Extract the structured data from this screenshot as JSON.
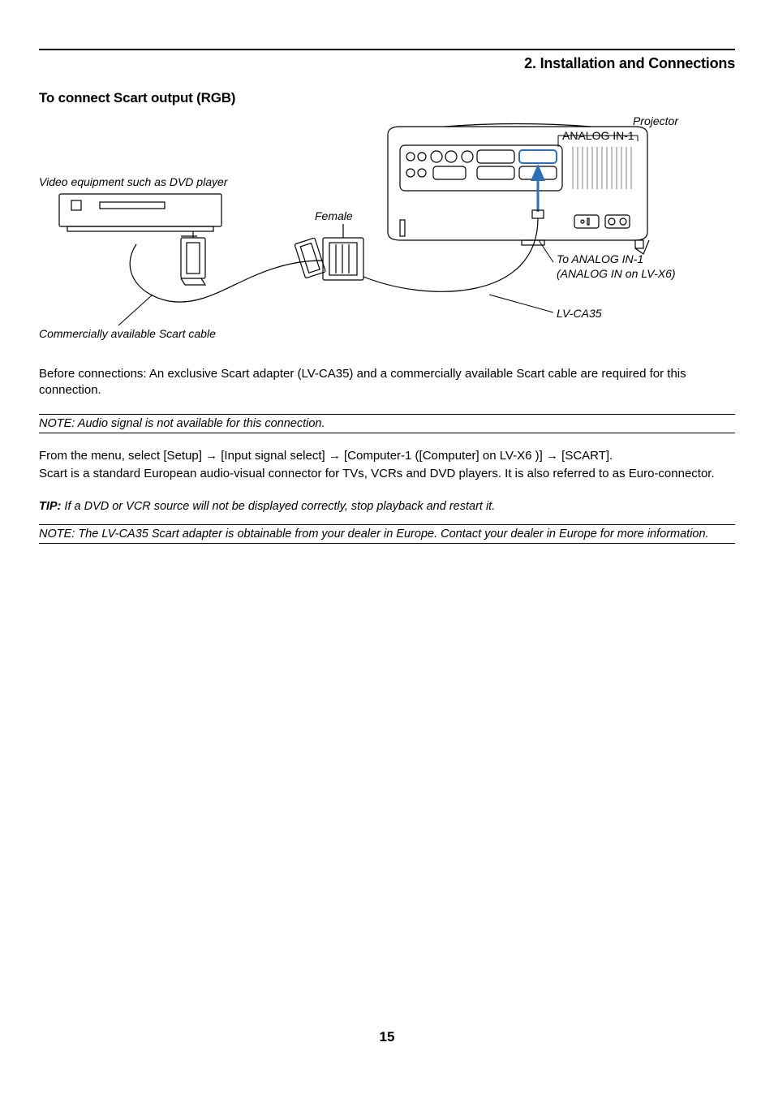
{
  "header": {
    "chapter": "2. Installation and Connections"
  },
  "section": {
    "title": "To connect Scart output (RGB)"
  },
  "diagram": {
    "projector_label": "Projector",
    "analog_in_label": "ANALOG IN-1",
    "to_analog_label_line1": "To ANALOG IN-1",
    "to_analog_label_line2": "(ANALOG IN on LV-X6)",
    "lv_ca35_label": "LV-CA35",
    "video_equipment_label": "Video equipment such as DVD player",
    "female_label": "Female",
    "scart_cable_label": "Commercially available Scart cable"
  },
  "body": {
    "before_connections": "Before connections: An exclusive Scart adapter (LV-CA35) and a commercially available Scart cable are required for this connection.",
    "note1": "NOTE: Audio signal is not available for this connection.",
    "menu_line1": "From the menu, select [Setup] → [Input signal select] → [Computer-1 ([Computer] on LV-X6 )] → [SCART].",
    "menu_line2": "Scart is a standard European audio-visual connector for TVs, VCRs and DVD players. It is also referred to as Euro-connector.",
    "tip_label": "TIP:",
    "tip_body": " If a DVD or VCR source will not be displayed correctly, stop playback and restart it.",
    "note2": "NOTE: The LV-CA35 Scart adapter is obtainable from your dealer in Europe. Contact your dealer in Europe for more information."
  },
  "page_number": "15"
}
